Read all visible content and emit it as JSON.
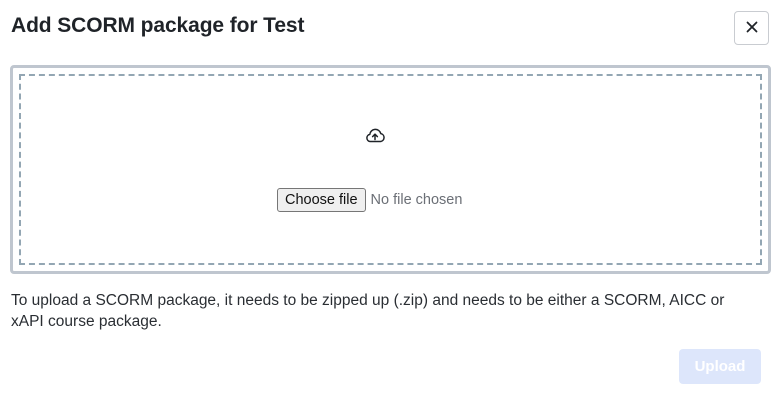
{
  "dialog": {
    "title": "Add SCORM package for Test",
    "close_label": "×"
  },
  "dropzone": {
    "icon": "cloud-upload-icon",
    "choose_file_label": "Choose file",
    "no_file_text": "No file chosen"
  },
  "help_text": "To upload a SCORM package, it needs to be zipped up (.zip) and needs to be either a SCORM, AICC or xAPI course package.",
  "footer": {
    "upload_label": "Upload",
    "upload_disabled": true
  },
  "colors": {
    "upload_button_bg": "#dde6fb",
    "dropzone_border": "#bfc6cf",
    "dropzone_dash": "#93a6b3"
  }
}
